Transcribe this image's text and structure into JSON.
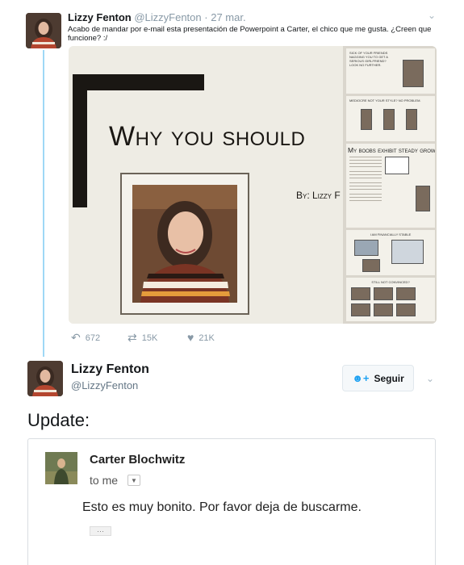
{
  "tweet1": {
    "name": "Lizzy Fenton",
    "handle": "@LizzyFenton",
    "dot": "·",
    "time": "27 mar.",
    "text": "Acabo de mandar por e-mail esta presentación de Powerpoint a Carter, el chico que me gusta. ¿Creen que funcione? :/",
    "slide": {
      "title": "Why you should",
      "by": "By: Lizzy F"
    },
    "thumbnails": {
      "slide3_title": "My boobs exhibit steady grow",
      "slide1_text": "Sick of your friends nagging you to get a serious girlfriend? Look no further.",
      "slide2_text": "Mediocre not your style? No problem.",
      "slide4_text": "I am financially stable",
      "slide5_text": "Still not convinced?"
    },
    "actions": {
      "replies": "672",
      "retweets": "15K",
      "likes": "21K"
    }
  },
  "tweet2": {
    "name": "Lizzy Fenton",
    "handle": "@LizzyFenton",
    "follow_label": "Seguir",
    "update_text": "Update:"
  },
  "email": {
    "sender": "Carter Blochwitz",
    "to": "to me",
    "body": "Esto es muy bonito. Por favor deja de buscarme.",
    "more": "···"
  },
  "icons": {
    "reply": "reply-icon",
    "retweet": "retweet-icon",
    "like": "heart-icon",
    "follow": "add-user-icon",
    "menu": "chevron-down-icon"
  },
  "colors": {
    "accent": "#1da1f2",
    "thread": "#9fd8f6",
    "muted": "#8899a6"
  }
}
